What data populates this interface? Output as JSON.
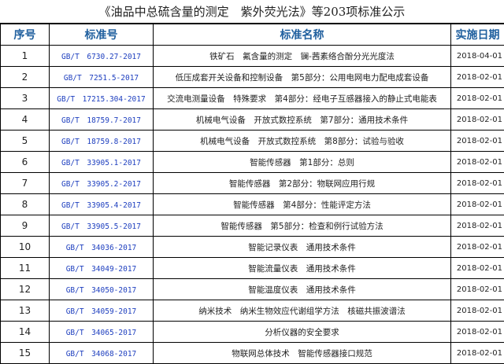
{
  "title": "《油品中总硫含量的测定　紫外荧光法》等203项标准公示",
  "headers": {
    "seq": "序号",
    "std": "标准号",
    "name": "标准名称",
    "date": "实施日期"
  },
  "rows": [
    {
      "seq": "1",
      "std": "GB/T　6730.27-2017",
      "name": "铁矿石　氟含量的测定　镧-茜素络合酚分光光度法",
      "date": "2018-04-01"
    },
    {
      "seq": "2",
      "std": "GB/T　7251.5-2017",
      "name": "低压成套开关设备和控制设备　第5部分：公用电网电力配电成套设备",
      "date": "2018-02-01"
    },
    {
      "seq": "3",
      "std": "GB/T　17215.304-2017",
      "name": "交流电测量设备　特殊要求　第4部分：经电子互感器接入的静止式电能表",
      "date": "2018-02-01"
    },
    {
      "seq": "4",
      "std": "GB/T　18759.7-2017",
      "name": "机械电气设备　开放式数控系统　第7部分：通用技术条件",
      "date": "2018-02-01"
    },
    {
      "seq": "5",
      "std": "GB/T　18759.8-2017",
      "name": "机械电气设备　开放式数控系统　第8部分：试验与验收",
      "date": "2018-02-01"
    },
    {
      "seq": "6",
      "std": "GB/T　33905.1-2017",
      "name": "智能传感器　第1部分：总则",
      "date": "2018-02-01"
    },
    {
      "seq": "7",
      "std": "GB/T　33905.2-2017",
      "name": "智能传感器　第2部分：物联网应用行规",
      "date": "2018-02-01"
    },
    {
      "seq": "8",
      "std": "GB/T　33905.4-2017",
      "name": "智能传感器　第4部分：性能评定方法",
      "date": "2018-02-01"
    },
    {
      "seq": "9",
      "std": "GB/T　33905.5-2017",
      "name": "智能传感器　第5部分：检查和例行试验方法",
      "date": "2018-02-01"
    },
    {
      "seq": "10",
      "std": "GB/T　34036-2017",
      "name": "智能记录仪表　通用技术条件",
      "date": "2018-02-01"
    },
    {
      "seq": "11",
      "std": "GB/T　34049-2017",
      "name": "智能流量仪表　通用技术条件",
      "date": "2018-02-01"
    },
    {
      "seq": "12",
      "std": "GB/T　34050-2017",
      "name": "智能温度仪表　通用技术条件",
      "date": "2018-02-01"
    },
    {
      "seq": "13",
      "std": "GB/T　34059-2017",
      "name": "纳米技术　纳米生物效应代谢组学方法　核磁共振波谱法",
      "date": "2018-02-01"
    },
    {
      "seq": "14",
      "std": "GB/T　34065-2017",
      "name": "分析仪器的安全要求",
      "date": "2018-02-01"
    },
    {
      "seq": "15",
      "std": "GB/T　34068-2017",
      "name": "物联网总体技术　智能传感器接口规范",
      "date": "2018-02-01"
    }
  ]
}
